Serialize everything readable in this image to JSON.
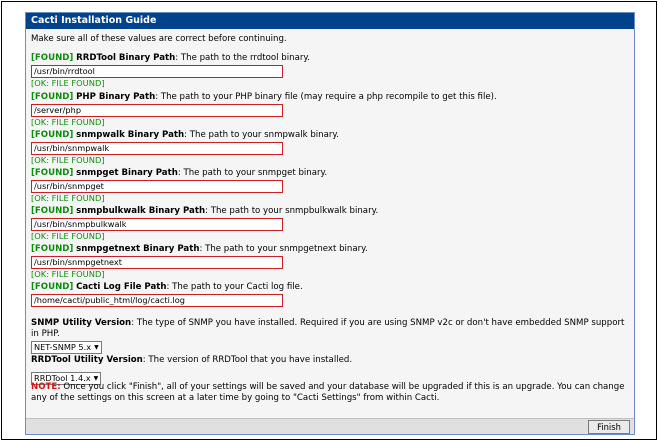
{
  "window": {
    "title": "Cacti Installation Guide"
  },
  "intro": "Make sure all of these values are correct before continuing.",
  "items": [
    {
      "status": "[FOUND]",
      "name": "RRDTool Binary Path",
      "desc": ": The path to the rrdtool binary.",
      "value": "/usr/bin/rrdtool",
      "ok": "[OK: FILE FOUND]"
    },
    {
      "status": "[FOUND]",
      "name": "PHP Binary Path",
      "desc": ": The path to your PHP binary file (may require a php recompile to get this file).",
      "value": "/server/php",
      "ok": "[OK: FILE FOUND]"
    },
    {
      "status": "[FOUND]",
      "name": "snmpwalk Binary Path",
      "desc": ": The path to your snmpwalk binary.",
      "value": "/usr/bin/snmpwalk",
      "ok": "[OK: FILE FOUND]"
    },
    {
      "status": "[FOUND]",
      "name": "snmpget Binary Path",
      "desc": ": The path to your snmpget binary.",
      "value": "/usr/bin/snmpget",
      "ok": "[OK: FILE FOUND]"
    },
    {
      "status": "[FOUND]",
      "name": "snmpbulkwalk Binary Path",
      "desc": ": The path to your snmpbulkwalk binary.",
      "value": "/usr/bin/snmpbulkwalk",
      "ok": "[OK: FILE FOUND]"
    },
    {
      "status": "[FOUND]",
      "name": "snmpgetnext Binary Path",
      "desc": ": The path to your snmpgetnext binary.",
      "value": "/usr/bin/snmpgetnext",
      "ok": "[OK: FILE FOUND]"
    },
    {
      "status": "[FOUND]",
      "name": "Cacti Log File Path",
      "desc": ": The path to your Cacti log file.",
      "value": "/home/cacti/public_html/log/cacti.log"
    }
  ],
  "snmp": {
    "name": "SNMP Utility Version",
    "desc": ": The type of SNMP you have installed. Required if you are using SNMP v2c or don't have embedded SNMP support in PHP.",
    "selected": "NET-SNMP 5.x"
  },
  "rrd": {
    "name": "RRDTool Utility Version",
    "desc": ": The version of RRDTool that you have installed.",
    "selected": "RRDTool 1.4.x"
  },
  "note": {
    "label": "NOTE:",
    "text": " Once you click \"Finish\", all of your settings will be saved and your database will be upgraded if this is an upgrade. You can change any of the settings on this screen at a later time by going to \"Cacti Settings\" from within Cacti."
  },
  "buttons": {
    "finish": "Finish"
  },
  "colors": {
    "title_bar": "#00438c",
    "found": "#0a8f0a",
    "highlight_border": "#cc2020",
    "note": "#dd1111"
  }
}
